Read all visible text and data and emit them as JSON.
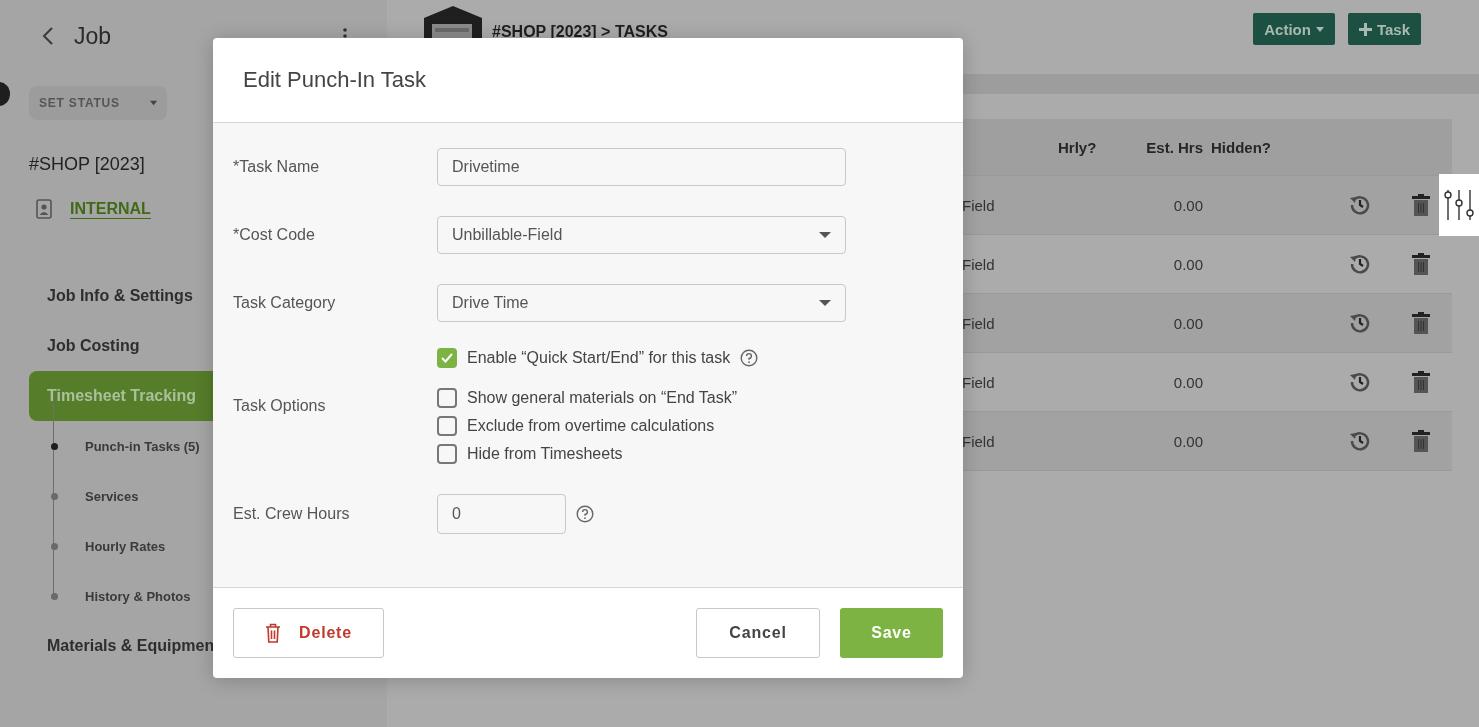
{
  "sidebar": {
    "title": "Job",
    "status_dropdown": "SET STATUS",
    "job_name": "#SHOP [2023]",
    "job_type": "INTERNAL",
    "nav": [
      {
        "label": "Job Info & Settings",
        "selected": false
      },
      {
        "label": "Job Costing",
        "selected": false
      },
      {
        "label": "Timesheet Tracking",
        "selected": true,
        "children": [
          {
            "label": "Punch-in Tasks (5)",
            "selected": true
          },
          {
            "label": "Services",
            "selected": false
          },
          {
            "label": "Hourly Rates",
            "selected": false
          },
          {
            "label": "History & Photos",
            "selected": false
          }
        ]
      },
      {
        "label": "Materials & Equipmen",
        "selected": false
      }
    ]
  },
  "main": {
    "breadcrumb": "#SHOP [2023] > TASKS",
    "buttons": [
      {
        "label": "Action",
        "kind": "dropdown"
      },
      {
        "label": "Task",
        "kind": "add"
      }
    ],
    "table": {
      "columns": [
        "Hrly?",
        "Est. Hrs",
        "Hidden?"
      ],
      "rows": [
        {
          "column_1": "Field",
          "est_hrs": "0.00"
        },
        {
          "column_1": "Field",
          "est_hrs": "0.00"
        },
        {
          "column_1": "Field",
          "est_hrs": "0.00"
        },
        {
          "column_1": "Field",
          "est_hrs": "0.00"
        },
        {
          "column_1": "Field",
          "est_hrs": "0.00"
        }
      ]
    }
  },
  "modal": {
    "title": "Edit Punch-In Task",
    "fields": [
      {
        "kind": "text",
        "label": "*Task Name",
        "value": "Drivetime"
      },
      {
        "kind": "select",
        "label": "*Cost Code",
        "value": "Unbillable-Field"
      },
      {
        "kind": "select",
        "label": "Task Category",
        "value": "Drive Time"
      },
      {
        "kind": "checkboxes",
        "label": "Task Options",
        "options": [
          {
            "label": "Enable “Quick Start/End” for this task",
            "checked": true,
            "help": true
          },
          {
            "label": "Show general materials on “End Task”",
            "checked": false,
            "help": false
          },
          {
            "label": "Exclude from overtime calculations",
            "checked": false,
            "help": false
          },
          {
            "label": "Hide from Timesheets",
            "checked": false,
            "help": false
          }
        ]
      },
      {
        "kind": "number",
        "label": "Est. Crew Hours",
        "value": "0",
        "help": true
      }
    ],
    "buttons": [
      {
        "label": "Delete",
        "kind": "delete"
      },
      {
        "label": "Cancel",
        "kind": "cancel"
      },
      {
        "label": "Save",
        "kind": "save"
      }
    ]
  }
}
